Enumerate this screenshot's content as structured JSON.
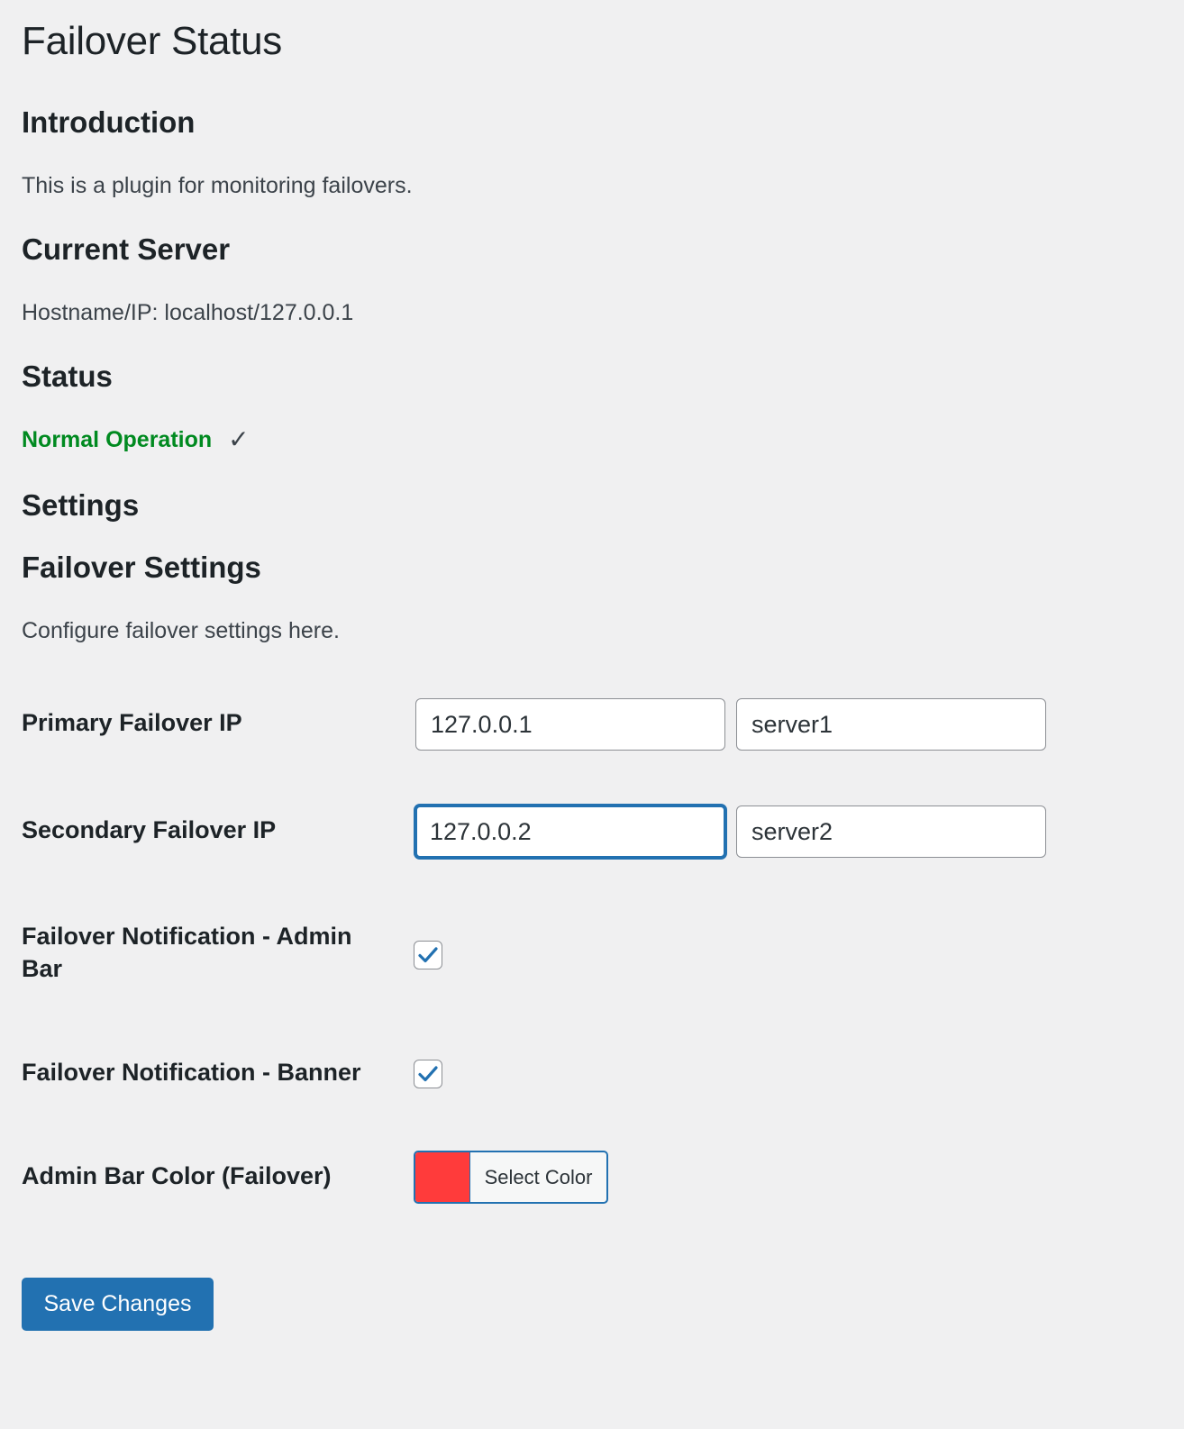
{
  "page": {
    "title": "Failover Status"
  },
  "introduction": {
    "heading": "Introduction",
    "text": "This is a plugin for monitoring failovers."
  },
  "current_server": {
    "heading": "Current Server",
    "text": "Hostname/IP: localhost/127.0.0.1"
  },
  "status": {
    "heading": "Status",
    "text": "Normal Operation",
    "check_glyph": "✓",
    "color": "#008a20"
  },
  "settings": {
    "heading": "Settings",
    "subheading": "Failover Settings",
    "description": "Configure failover settings here.",
    "primary": {
      "label": "Primary Failover IP",
      "ip_value": "127.0.0.1",
      "name_value": "server1"
    },
    "secondary": {
      "label": "Secondary Failover IP",
      "ip_value": "127.0.0.2",
      "name_value": "server2",
      "ip_focused": true
    },
    "notify_admin_bar": {
      "label": "Failover Notification - Admin Bar",
      "checked": true,
      "icon": "checkmark-icon"
    },
    "notify_banner": {
      "label": "Failover Notification - Banner",
      "checked": true,
      "icon": "checkmark-icon"
    },
    "admin_bar_color": {
      "label": "Admin Bar Color (Failover)",
      "button_label": "Select Color",
      "swatch_color": "#ff3b3b"
    }
  },
  "actions": {
    "save_label": "Save Changes"
  },
  "theme": {
    "accent": "#2271b1",
    "background": "#f0f0f1"
  }
}
